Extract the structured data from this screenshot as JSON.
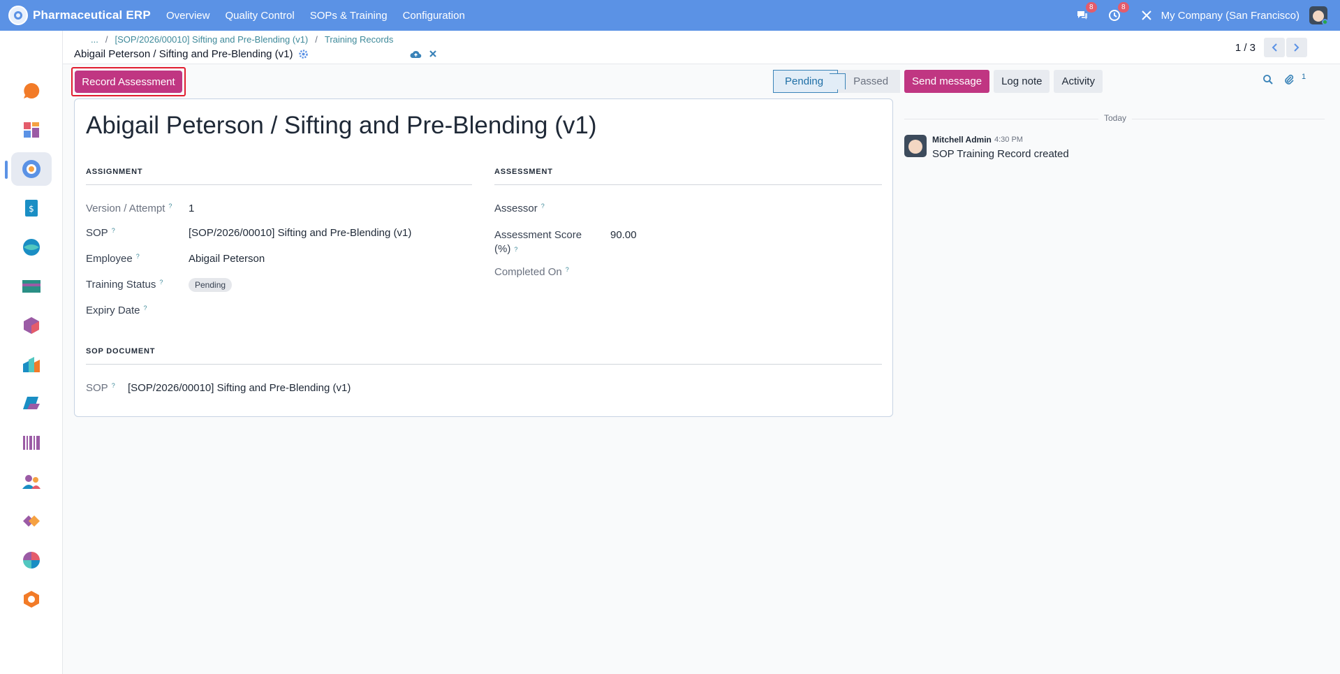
{
  "app": {
    "name": "Pharmaceutical ERP"
  },
  "topmenu": [
    "Overview",
    "Quality Control",
    "SOPs & Training",
    "Configuration"
  ],
  "topbar": {
    "messages_count": "8",
    "activities_count": "8",
    "company": "My Company (San Francisco)"
  },
  "breadcrumb": {
    "ellipsis": "...",
    "sep": "/",
    "items": [
      "[SOP/2026/00010] Sifting and Pre-Blending (v1)",
      "Training Records"
    ]
  },
  "record": {
    "title": "Abigail Peterson / Sifting and Pre-Blending (v1)"
  },
  "pager": {
    "value": "1 / 3"
  },
  "actions": {
    "record_assessment": "Record Assessment"
  },
  "statusbar": {
    "stages": [
      "Pending",
      "Passed"
    ],
    "current": "Pending"
  },
  "form": {
    "heading": "Abigail Peterson / Sifting and Pre-Blending (v1)",
    "help_mark": "?",
    "assignment": {
      "title": "ASSIGNMENT",
      "version_label": "Version / Attempt",
      "version_value": "1",
      "sop_label": "SOP",
      "sop_value": "[SOP/2026/00010] Sifting and Pre-Blending (v1)",
      "employee_label": "Employee",
      "employee_value": "Abigail Peterson",
      "status_label": "Training Status",
      "status_value": "Pending",
      "expiry_label": "Expiry Date"
    },
    "assessment": {
      "title": "ASSESSMENT",
      "assessor_label": "Assessor",
      "score_label_1": "Assessment Score",
      "score_label_2": "(%)",
      "score_value": "90.00",
      "completed_label": "Completed On"
    },
    "sop_document": {
      "title": "SOP DOCUMENT",
      "sop_label": "SOP",
      "sop_value": "[SOP/2026/00010] Sifting and Pre-Blending (v1)"
    }
  },
  "chatter": {
    "send_message": "Send message",
    "log_note": "Log note",
    "activity": "Activity",
    "attachments_count": "1",
    "date_separator": "Today",
    "messages": [
      {
        "author": "Mitchell Admin",
        "time": "4:30 PM",
        "body": "SOP Training Record created"
      }
    ]
  },
  "colors": {
    "navbar": "#5b92e5",
    "primary": "#c03682",
    "highlight_border": "#e11d2f"
  },
  "sidebar_icons": [
    "discuss-icon",
    "dashboards-icon",
    "pharma-erp-icon",
    "invoicing-icon",
    "crm-icon",
    "accounting-icon",
    "inventory-icon",
    "reporting-icon",
    "purchase-icon",
    "barcode-icon",
    "employees-icon",
    "sales-icon",
    "documents-icon",
    "settings-icon"
  ]
}
